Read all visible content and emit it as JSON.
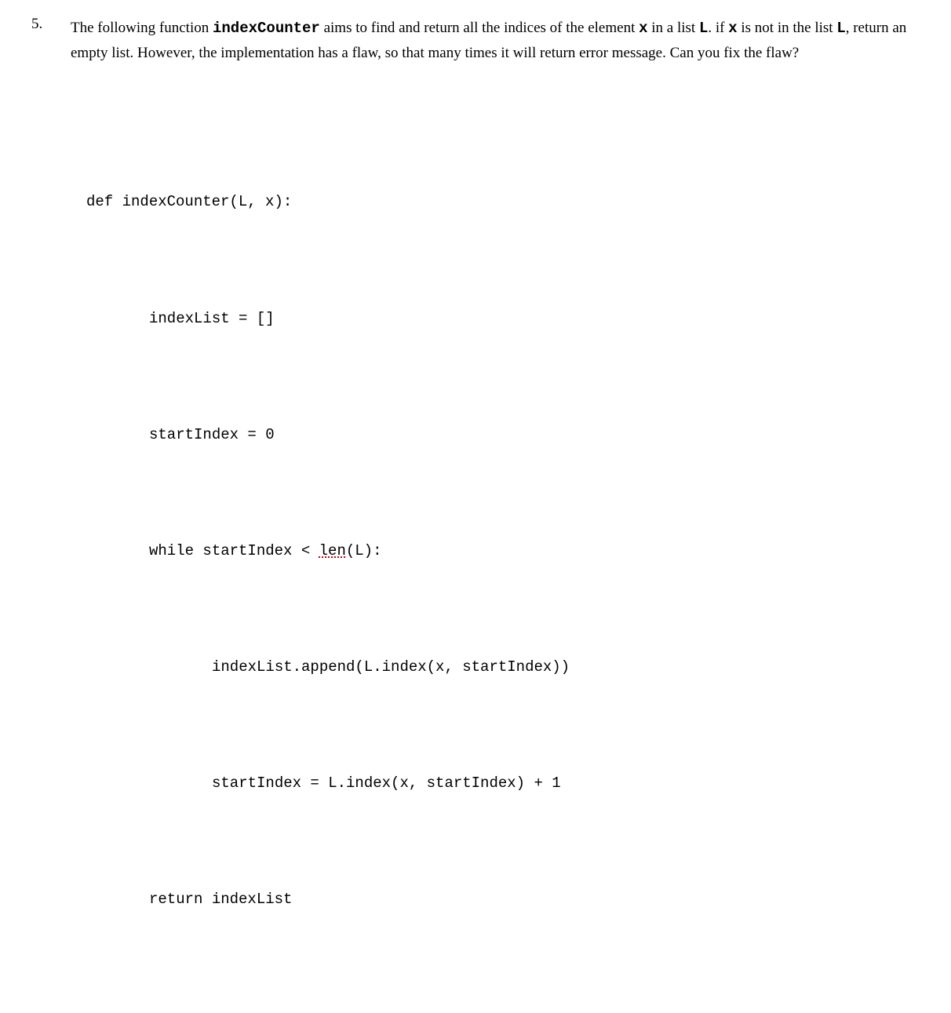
{
  "question": {
    "number": "5.",
    "text_parts": {
      "p1": "The following function ",
      "fn_name": "indexCounter",
      "p2": " aims to find and return all the indices of the element ",
      "var_x1": "x",
      "p3": " in a list ",
      "var_L1": "L",
      "p4": ". if ",
      "var_x2": "x",
      "p5": " is not in the list ",
      "var_L2": "L",
      "p6": ", return an empty list. However, the implementation has a flaw, so that many times it will return error message. Can you fix the flaw?"
    }
  },
  "code": {
    "line1": "def indexCounter(L, x):",
    "line2": "indexList = []",
    "line3": "startIndex = 0",
    "line4a": "while startIndex < ",
    "line4_squiggle": "len",
    "line4b": "(L):",
    "line5": "indexList.append(L.index(x, startIndex))",
    "line6": "startIndex = L.index(x, startIndex) + 1",
    "line7": "return indexList"
  }
}
